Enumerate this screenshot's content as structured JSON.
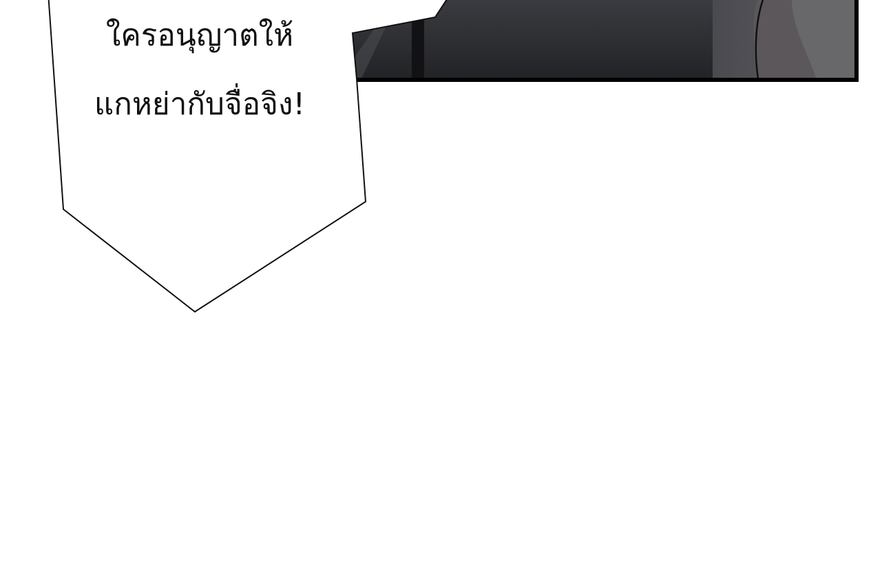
{
  "speech_bubble": {
    "lines": [
      "ใครอนุญาตให้",
      "แกหย่ากับจื่อจิง!"
    ]
  },
  "colors": {
    "panel_dark": "#2a2b2f",
    "panel_border": "#000000",
    "page_background": "#ffffff",
    "bubble_fill": "#ffffff",
    "bubble_stroke": "#111111"
  }
}
